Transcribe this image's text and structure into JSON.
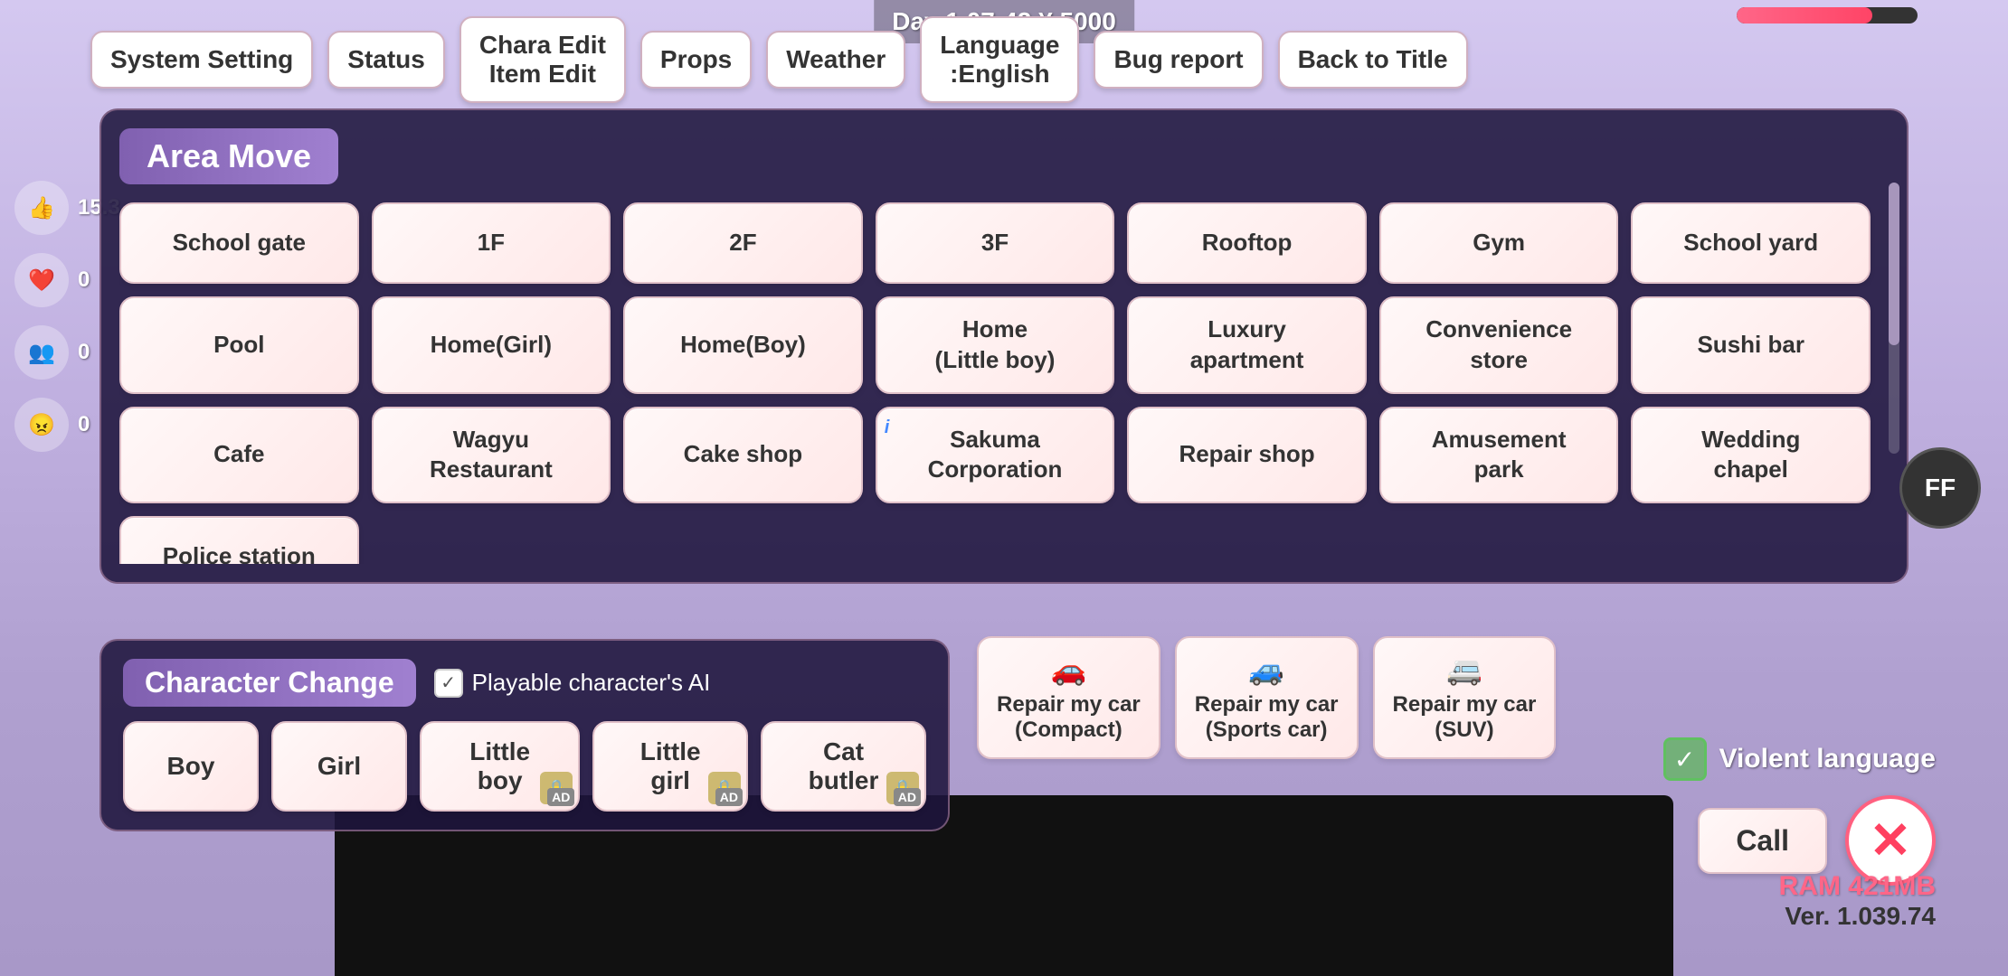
{
  "topInfo": {
    "dayText": "Day 1  07:42  ¥ 5000",
    "progressPercent": 75
  },
  "toolbar": {
    "buttons": [
      {
        "id": "system-setting",
        "label": "System Setting"
      },
      {
        "id": "status",
        "label": "Status"
      },
      {
        "id": "chara-edit",
        "label": "Chara Edit\nItem Edit"
      },
      {
        "id": "props",
        "label": "Props"
      },
      {
        "id": "weather",
        "label": "Weather"
      },
      {
        "id": "language",
        "label": "Language\n:English"
      },
      {
        "id": "bug-report",
        "label": "Bug report"
      },
      {
        "id": "back-to-title",
        "label": "Back to Title"
      }
    ]
  },
  "areaMove": {
    "title": "Area Move",
    "locations": [
      "School gate",
      "1F",
      "2F",
      "3F",
      "Rooftop",
      "Gym",
      "School yard",
      "Pool",
      "Home(Girl)",
      "Home(Boy)",
      "Home\n(Little boy)",
      "Luxury\napartment",
      "Convenience\nstore",
      "Sushi bar",
      "Cafe",
      "Wagyu\nRestaurant",
      "Cake shop",
      "Sakuma\nCorporation",
      "Repair shop",
      "Amusement\npark",
      "Wedding\nchapel",
      "Police station",
      "",
      "",
      "",
      "",
      "",
      ""
    ]
  },
  "characterChange": {
    "title": "Character Change",
    "aiCheckbox": {
      "label": "Playable character's AI",
      "checked": true
    },
    "characters": [
      {
        "id": "boy",
        "label": "Boy",
        "locked": false,
        "ad": false
      },
      {
        "id": "girl",
        "label": "Girl",
        "locked": false,
        "ad": false
      },
      {
        "id": "little-boy",
        "label": "Little boy",
        "locked": true,
        "ad": true
      },
      {
        "id": "little-girl",
        "label": "Little girl",
        "locked": true,
        "ad": true
      },
      {
        "id": "cat-butler",
        "label": "Cat butler",
        "locked": true,
        "ad": true
      }
    ]
  },
  "carRepair": {
    "buttons": [
      {
        "id": "compact",
        "label": "Repair my car\n(Compact)",
        "iconColor": "#cc2244"
      },
      {
        "id": "sports",
        "label": "Repair my car\n(Sports car)",
        "iconColor": "#2244cc"
      },
      {
        "id": "suv",
        "label": "Repair my car\n(SUV)",
        "iconColor": "#888888"
      }
    ]
  },
  "violentLanguage": {
    "label": "Violent language",
    "checked": true
  },
  "callButton": {
    "label": "Call"
  },
  "ramInfo": {
    "ram": "RAM 421MB",
    "version": "Ver. 1.039.74"
  },
  "ffButton": {
    "label": "FF"
  },
  "leftStats": [
    {
      "icon": "👍",
      "value": "15.3"
    },
    {
      "icon": "❤️",
      "value": "0"
    },
    {
      "icon": "👥",
      "value": "0"
    },
    {
      "icon": "😠",
      "value": "0"
    }
  ]
}
